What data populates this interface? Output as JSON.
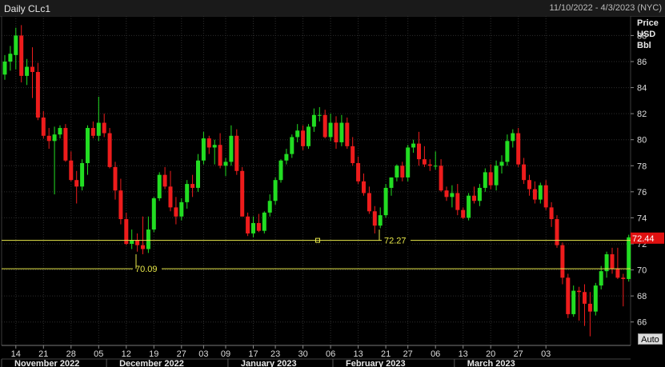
{
  "header": {
    "title": "Daily CLc1",
    "range": "11/10/2022 - 4/3/2023 (NYC)"
  },
  "auto_button": "Auto",
  "chart_data": {
    "type": "candlestick",
    "title": "Daily CLc1",
    "ylabel": "Price USD Bbl",
    "ylabel_lines": [
      "Price",
      "USD",
      "Bbl"
    ],
    "ylim": [
      64.2,
      89.5
    ],
    "yticks": [
      66,
      68,
      70,
      72,
      74,
      76,
      78,
      80,
      82,
      84,
      86,
      88
    ],
    "grid": true,
    "x_day_ticks": [
      {
        "label": "14",
        "index": 2
      },
      {
        "label": "21",
        "index": 7
      },
      {
        "label": "28",
        "index": 12
      },
      {
        "label": "05",
        "index": 17
      },
      {
        "label": "12",
        "index": 22
      },
      {
        "label": "19",
        "index": 27
      },
      {
        "label": "27",
        "index": 32
      },
      {
        "label": "03",
        "index": 36
      },
      {
        "label": "09",
        "index": 40
      },
      {
        "label": "17",
        "index": 45
      },
      {
        "label": "23",
        "index": 49
      },
      {
        "label": "30",
        "index": 54
      },
      {
        "label": "06",
        "index": 59
      },
      {
        "label": "13",
        "index": 64
      },
      {
        "label": "21",
        "index": 69
      },
      {
        "label": "27",
        "index": 73
      },
      {
        "label": "06",
        "index": 78
      },
      {
        "label": "13",
        "index": 83
      },
      {
        "label": "20",
        "index": 88
      },
      {
        "label": "27",
        "index": 93
      },
      {
        "label": "03",
        "index": 98
      }
    ],
    "x_months": [
      {
        "label": "November 2022",
        "index": 0
      },
      {
        "label": "December 2022",
        "index": 19
      },
      {
        "label": "January 2023",
        "index": 41
      },
      {
        "label": "February 2023",
        "index": 60
      },
      {
        "label": "March 2023",
        "index": 82
      }
    ],
    "candles": [
      [
        85.0,
        86.5,
        84.6,
        86.0
      ],
      [
        86.0,
        87.2,
        85.3,
        86.6
      ],
      [
        86.5,
        88.6,
        85.4,
        88.0
      ],
      [
        88.0,
        88.8,
        84.4,
        84.9
      ],
      [
        84.9,
        86.2,
        84.2,
        85.6
      ],
      [
        85.6,
        87.1,
        83.2,
        85.2
      ],
      [
        85.2,
        85.9,
        81.5,
        81.7
      ],
      [
        81.7,
        82.2,
        80.1,
        80.3
      ],
      [
        80.3,
        80.9,
        79.3,
        79.9
      ],
      [
        79.9,
        81.0,
        75.8,
        80.4
      ],
      [
        80.4,
        81.1,
        80.1,
        80.9
      ],
      [
        80.9,
        81.2,
        78.3,
        78.4
      ],
      [
        78.4,
        79.1,
        76.8,
        76.9
      ],
      [
        76.9,
        77.6,
        75.1,
        76.4
      ],
      [
        76.4,
        78.5,
        76.1,
        78.2
      ],
      [
        78.2,
        81.1,
        77.3,
        80.9
      ],
      [
        80.9,
        81.4,
        80.1,
        80.3
      ],
      [
        80.3,
        83.3,
        79.9,
        81.3
      ],
      [
        81.3,
        82.0,
        80.2,
        80.5
      ],
      [
        80.5,
        80.9,
        77.8,
        77.9
      ],
      [
        77.9,
        78.3,
        75.4,
        76.1
      ],
      [
        76.1,
        77.0,
        73.5,
        73.9
      ],
      [
        73.9,
        74.4,
        71.9,
        72.0
      ],
      [
        72.0,
        73.1,
        71.6,
        72.3
      ],
      [
        72.3,
        72.8,
        71.4,
        71.9
      ],
      [
        71.9,
        74.1,
        71.2,
        71.6
      ],
      [
        71.6,
        74.1,
        71.3,
        73.1
      ],
      [
        73.1,
        75.6,
        72.9,
        75.5
      ],
      [
        75.5,
        77.5,
        75.3,
        77.3
      ],
      [
        77.3,
        77.9,
        76.2,
        76.4
      ],
      [
        76.4,
        77.6,
        74.5,
        74.8
      ],
      [
        74.8,
        75.6,
        73.5,
        74.1
      ],
      [
        74.1,
        75.5,
        73.8,
        75.2
      ],
      [
        75.2,
        76.9,
        74.7,
        76.6
      ],
      [
        76.6,
        77.3,
        75.6,
        76.3
      ],
      [
        76.3,
        78.9,
        76.0,
        78.4
      ],
      [
        78.4,
        80.6,
        78.1,
        80.1
      ],
      [
        80.1,
        80.3,
        78.9,
        79.4
      ],
      [
        79.4,
        80.0,
        78.1,
        79.6
      ],
      [
        79.6,
        80.5,
        77.8,
        78.0
      ],
      [
        78.0,
        78.6,
        77.2,
        78.3
      ],
      [
        78.3,
        81.1,
        78.0,
        80.3
      ],
      [
        80.3,
        80.8,
        77.3,
        77.6
      ],
      [
        77.6,
        77.9,
        74.1,
        74.1
      ],
      [
        74.1,
        74.4,
        72.6,
        72.8
      ],
      [
        72.8,
        74.1,
        72.5,
        73.6
      ],
      [
        73.6,
        74.3,
        72.9,
        73.0
      ],
      [
        73.0,
        74.5,
        72.8,
        74.4
      ],
      [
        74.4,
        75.8,
        74.1,
        75.3
      ],
      [
        75.3,
        77.1,
        75.0,
        76.9
      ],
      [
        76.9,
        78.5,
        76.7,
        78.4
      ],
      [
        78.4,
        79.3,
        78.1,
        78.9
      ],
      [
        78.9,
        80.4,
        78.6,
        80.2
      ],
      [
        80.2,
        81.2,
        79.8,
        80.7
      ],
      [
        80.7,
        81.1,
        79.2,
        79.5
      ],
      [
        79.5,
        81.2,
        79.3,
        81.0
      ],
      [
        81.0,
        82.4,
        80.6,
        81.9
      ],
      [
        81.9,
        82.5,
        81.4,
        81.9
      ],
      [
        81.9,
        82.3,
        80.1,
        80.2
      ],
      [
        80.2,
        82.0,
        79.9,
        81.3
      ],
      [
        81.3,
        81.8,
        79.3,
        79.8
      ],
      [
        79.8,
        81.9,
        79.5,
        81.3
      ],
      [
        81.3,
        81.7,
        79.3,
        79.5
      ],
      [
        79.5,
        80.2,
        78.0,
        78.2
      ],
      [
        78.2,
        78.7,
        76.6,
        76.8
      ],
      [
        76.8,
        77.4,
        75.7,
        75.9
      ],
      [
        75.9,
        76.4,
        74.3,
        74.5
      ],
      [
        74.5,
        74.9,
        72.8,
        73.4
      ],
      [
        73.4,
        74.8,
        73.2,
        74.2
      ],
      [
        74.2,
        76.6,
        74.0,
        76.3
      ],
      [
        76.3,
        77.1,
        75.7,
        77.1
      ],
      [
        77.1,
        78.1,
        76.8,
        78.0
      ],
      [
        78.0,
        78.3,
        76.8,
        77.1
      ],
      [
        77.1,
        79.6,
        76.8,
        79.4
      ],
      [
        79.4,
        80.0,
        79.0,
        79.7
      ],
      [
        79.7,
        80.6,
        78.0,
        78.5
      ],
      [
        78.5,
        79.5,
        77.9,
        78.1
      ],
      [
        78.1,
        78.5,
        77.6,
        78.0
      ],
      [
        78.0,
        79.1,
        77.7,
        78.0
      ],
      [
        78.0,
        78.5,
        76.0,
        76.1
      ],
      [
        76.1,
        76.4,
        75.3,
        75.6
      ],
      [
        75.6,
        76.5,
        74.8,
        75.9
      ],
      [
        75.9,
        76.6,
        74.2,
        74.6
      ],
      [
        74.6,
        74.8,
        73.9,
        74.0
      ],
      [
        74.0,
        75.9,
        73.8,
        75.7
      ],
      [
        75.7,
        76.4,
        75.1,
        75.3
      ],
      [
        75.3,
        76.6,
        74.9,
        76.3
      ],
      [
        76.3,
        77.8,
        76.0,
        77.5
      ],
      [
        77.5,
        78.1,
        76.2,
        76.5
      ],
      [
        76.5,
        78.4,
        76.1,
        78.0
      ],
      [
        78.0,
        78.8,
        77.4,
        78.3
      ],
      [
        78.3,
        80.4,
        78.0,
        79.9
      ],
      [
        79.9,
        80.8,
        79.4,
        80.5
      ],
      [
        80.5,
        80.9,
        77.9,
        78.1
      ],
      [
        78.1,
        78.6,
        76.6,
        76.9
      ],
      [
        76.9,
        77.3,
        75.7,
        76.2
      ],
      [
        76.2,
        76.8,
        75.1,
        75.4
      ],
      [
        75.4,
        76.7,
        75.1,
        76.5
      ],
      [
        76.5,
        76.9,
        74.6,
        74.8
      ],
      [
        74.8,
        75.2,
        73.3,
        73.9
      ],
      [
        73.9,
        74.2,
        71.7,
        71.9
      ],
      [
        71.9,
        72.1,
        68.9,
        69.4
      ],
      [
        69.4,
        69.7,
        66.3,
        66.6
      ],
      [
        66.6,
        68.8,
        66.4,
        68.4
      ],
      [
        68.4,
        68.7,
        66.1,
        68.3
      ],
      [
        68.3,
        68.9,
        65.7,
        67.4
      ],
      [
        67.4,
        68.3,
        64.9,
        66.8
      ],
      [
        66.8,
        69.0,
        66.5,
        68.8
      ],
      [
        68.8,
        70.3,
        68.5,
        69.9
      ],
      [
        69.9,
        71.4,
        69.4,
        71.2
      ],
      [
        71.2,
        71.7,
        69.7,
        70.1
      ],
      [
        70.1,
        71.7,
        69.3,
        69.4
      ],
      [
        69.4,
        69.7,
        67.2,
        69.3
      ],
      [
        69.3,
        72.7,
        69.1,
        72.5
      ]
    ],
    "hlines": [
      {
        "value": 72.27,
        "label": "72.27"
      },
      {
        "value": 70.09,
        "label": "70.09"
      }
    ],
    "last_price": "72.44"
  }
}
